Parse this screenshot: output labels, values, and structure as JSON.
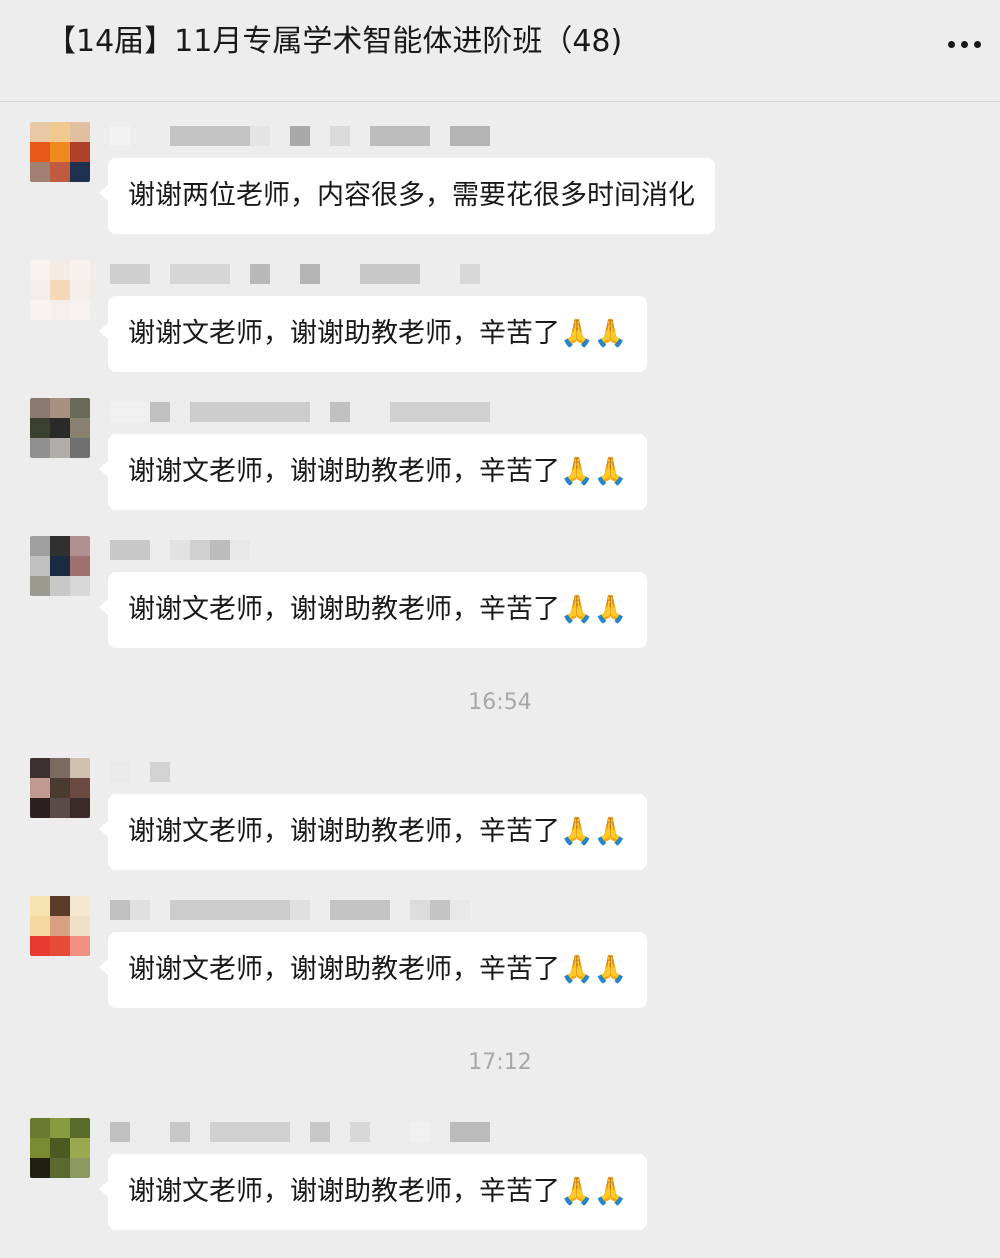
{
  "header": {
    "title": "【14届】11月专属学术智能体进阶班（48)",
    "more_icon": "more-dots-icon"
  },
  "messages": [
    {
      "text": "谢谢两位老师，内容很多，需要花很多时间消化"
    },
    {
      "text": "谢谢文老师，谢谢助教老师，辛苦了🙏🙏"
    },
    {
      "text": "谢谢文老师，谢谢助教老师，辛苦了🙏🙏"
    },
    {
      "text": "谢谢文老师，谢谢助教老师，辛苦了🙏🙏"
    },
    {
      "text": "谢谢文老师，谢谢助教老师，辛苦了🙏🙏"
    },
    {
      "text": "谢谢文老师，谢谢助教老师，辛苦了🙏🙏"
    },
    {
      "text": "谢谢文老师，谢谢助教老师，辛苦了🙏🙏"
    }
  ],
  "timestamps": [
    "16:54",
    "17:12"
  ],
  "colors": {
    "background": "#ededed",
    "bubble": "#ffffff",
    "timestamp": "#a8a8a8"
  }
}
